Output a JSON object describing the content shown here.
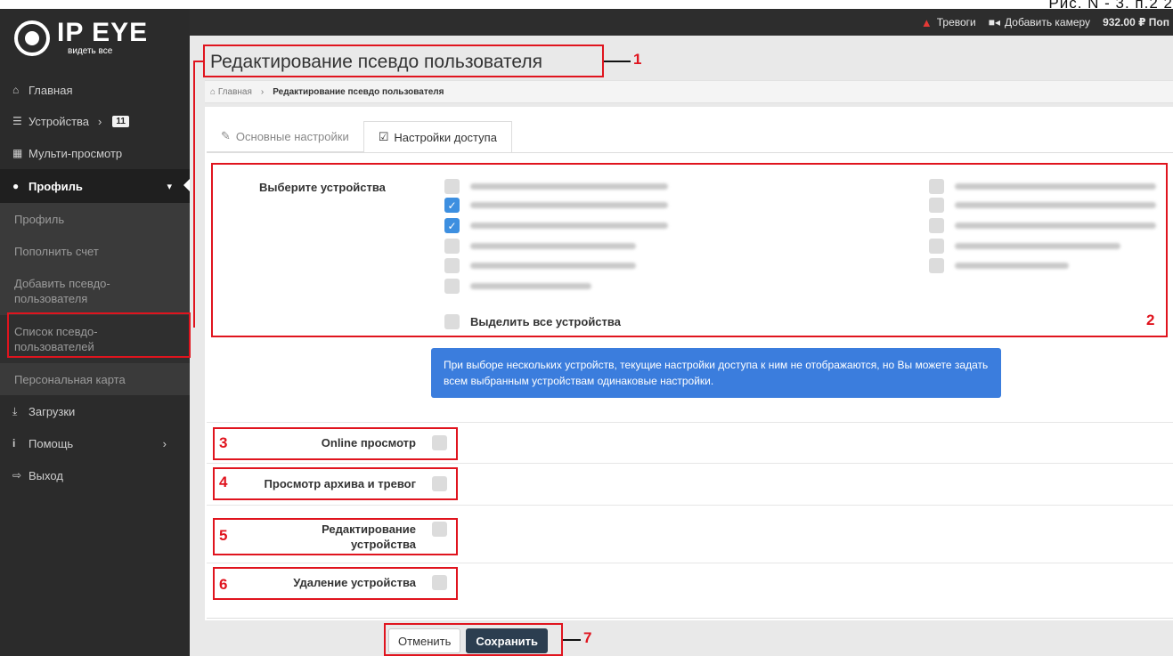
{
  "corner_label": "Рис. N - 3. п.2 2",
  "topbar": {
    "alarms": "Тревоги",
    "add_camera": "Добавить камеру",
    "balance": "932.00 ₽ Поп"
  },
  "logo": {
    "name": "IP EYE",
    "tagline": "видеть все"
  },
  "sidebar": {
    "items": [
      {
        "label": "Главная",
        "icon": "home-icon"
      },
      {
        "label": "Устройства",
        "icon": "list-icon",
        "badge": "11"
      },
      {
        "label": "Мульти-просмотр",
        "icon": "grid-icon"
      },
      {
        "label": "Профиль",
        "icon": "user-icon"
      },
      {
        "label": "Загрузки",
        "icon": "download-icon"
      },
      {
        "label": "Помощь",
        "icon": "info-icon"
      },
      {
        "label": "Выход",
        "icon": "logout-icon"
      }
    ],
    "profile_sub": [
      {
        "label": "Профиль"
      },
      {
        "label": "Пополнить счет"
      },
      {
        "label": "Добавить псевдо-пользователя"
      },
      {
        "label": "Список псевдо-пользователей"
      },
      {
        "label": "Персональная карта"
      }
    ]
  },
  "page": {
    "title": "Редактирование псевдо пользователя",
    "breadcrumb": {
      "home": "Главная",
      "current": "Редактирование псевдо пользователя"
    },
    "tabs": [
      {
        "label": "Основные настройки",
        "active": false
      },
      {
        "label": "Настройки доступа",
        "active": true
      }
    ]
  },
  "devices": {
    "label": "Выберите устройства",
    "left": [
      {
        "checked": false
      },
      {
        "checked": true
      },
      {
        "checked": true
      },
      {
        "checked": false
      },
      {
        "checked": false
      },
      {
        "checked": false
      }
    ],
    "right": [
      {
        "checked": false
      },
      {
        "checked": false
      },
      {
        "checked": false
      },
      {
        "checked": false
      },
      {
        "checked": false
      }
    ],
    "select_all": "Выделить все устройства"
  },
  "alert_text": "При выборе нескольких устройств, текущие настройки доступа к ним не отображаются, но Вы можете задать всем выбранным устройствам одинаковые настройки.",
  "permissions": [
    {
      "label": "Online просмотр",
      "checked": false
    },
    {
      "label": "Просмотр архива и тревог",
      "checked": false
    },
    {
      "label": "Редактирование устройства",
      "checked": false
    },
    {
      "label": "Удаление устройства",
      "checked": false
    }
  ],
  "buttons": {
    "cancel": "Отменить",
    "save": "Сохранить"
  },
  "annotations": {
    "n1": "1",
    "n2": "2",
    "n3": "3",
    "n4": "4",
    "n5": "5",
    "n6": "6",
    "n7": "7"
  },
  "colors": {
    "annotation": "#e0141e",
    "checkbox_on": "#3d8fe0",
    "alert_bg": "#3b7ddd",
    "sidebar_bg": "#2b2b2b"
  }
}
